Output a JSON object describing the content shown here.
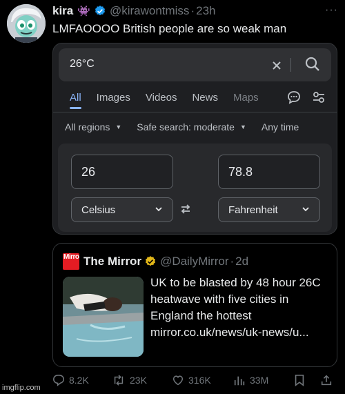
{
  "tweet": {
    "author_name": "kira",
    "name_emoji": "👾",
    "handle": "@kirawontmiss",
    "time": "23h",
    "more_label": "···",
    "text": "LMFAOOOO British people are so weak man"
  },
  "search": {
    "query": "26°C",
    "tabs": [
      "All",
      "Images",
      "Videos",
      "News",
      "Maps"
    ],
    "active_tab": "All",
    "filters": [
      "All regions",
      "Safe search: moderate",
      "Any time"
    ],
    "accent": "#8ab4f8"
  },
  "converter": {
    "from_value": "26",
    "to_value": "78.8",
    "from_unit": "Celsius",
    "to_unit": "Fahrenheit"
  },
  "quote": {
    "logo_text": "Mirror",
    "author_name": "The Mirror",
    "handle": "@DailyMirror",
    "time": "2d",
    "text": "UK to be blasted by 48 hour 26C heatwave with five cities in England the hottest mirror.co.uk/news/uk-news/u..."
  },
  "actions": {
    "replies": "8.2K",
    "reposts": "23K",
    "likes": "316K",
    "views": "33M"
  },
  "watermark": "imgflip.com",
  "colors": {
    "background": "#000000",
    "verified_blue": "#1d9bf0",
    "verified_gold": "#e2b719",
    "mirror_red": "#e31c23"
  }
}
